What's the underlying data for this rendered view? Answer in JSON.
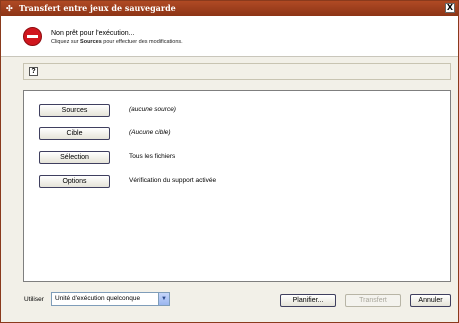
{
  "window": {
    "title": "Transfert entre jeux de sauvegarde",
    "close_label": "X"
  },
  "status": {
    "title": "Non prêt pour l'exécution...",
    "sub_prefix": "Cliquez sur ",
    "sub_bold": "Sources",
    "sub_suffix": " pour effectuer des modifications."
  },
  "help": {
    "icon_glyph": "?"
  },
  "rows": [
    {
      "button": "Sources",
      "value": "(aucune source)"
    },
    {
      "button": "Cible",
      "value": "(Aucune cible)"
    },
    {
      "button": "Sélection",
      "value": "Tous les fichiers"
    },
    {
      "button": "Options",
      "value": "Vérification du support activée"
    }
  ],
  "footer": {
    "use_label": "Utiliser",
    "device_select": "Unité d'exécution quelconque",
    "schedule_button": "Planifier...",
    "transfer_button": "Transfert",
    "cancel_button": "Annuler"
  },
  "colors": {
    "titlebar": "#9c3f1c",
    "stop": "#d0161e"
  }
}
